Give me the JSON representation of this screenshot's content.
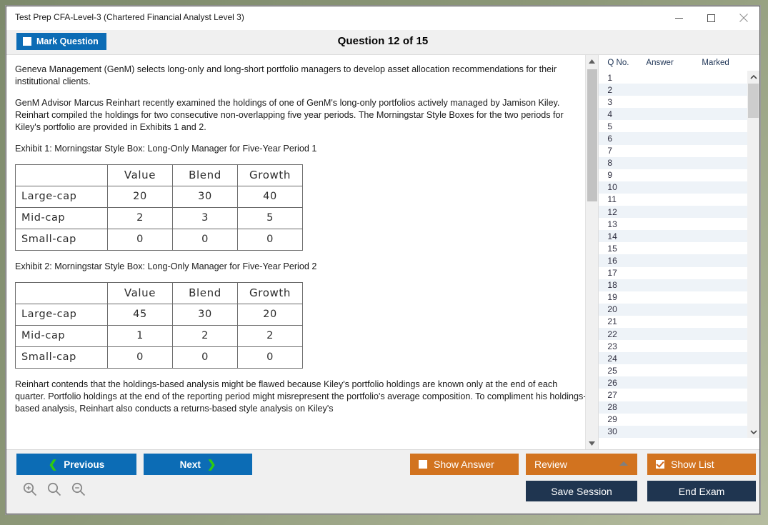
{
  "window": {
    "title": "Test Prep CFA-Level-3 (Chartered Financial Analyst Level 3)",
    "minimize_label": "minimize",
    "maximize_label": "maximize",
    "close_label": "close"
  },
  "header": {
    "mark_question_label": "Mark Question",
    "mark_question_checked": false,
    "question_title": "Question 12 of 15"
  },
  "content": {
    "paragraphs": [
      "Geneva Management (GenM) selects long-only and long-short portfolio managers to develop asset allocation recommendations for their institutional clients.",
      "GenM Advisor Marcus Reinhart recently examined the holdings of one of GenM's long-only portfolios actively managed by Jamison Kiley. Reinhart compiled the holdings for two consecutive non-overlapping five year periods. The Morningstar Style Boxes for the two periods for Kiley's portfolio are provided in Exhibits 1 and 2."
    ],
    "exhibit1_label": "Exhibit 1: Morningstar Style Box: Long-Only Manager for Five-Year Period 1",
    "exhibit2_label": "Exhibit 2: Morningstar Style Box: Long-Only Manager for Five-Year Period 2",
    "closing_paragraph": "Reinhart contends that the holdings-based analysis might be flawed because Kiley's portfolio holdings are known only at the end of each quarter. Portfolio holdings at the end of the reporting period might misrepresent the portfolio's average composition. To compliment his holdings-based analysis, Reinhart also conducts a returns-based style analysis on Kiley's",
    "exhibit1": {
      "corner": "",
      "columns": [
        "Value",
        "Blend",
        "Growth"
      ],
      "rows": [
        {
          "label": "Large-cap",
          "values": [
            "20",
            "30",
            "40"
          ]
        },
        {
          "label": "Mid-cap",
          "values": [
            "2",
            "3",
            "5"
          ]
        },
        {
          "label": "Small-cap",
          "values": [
            "0",
            "0",
            "0"
          ]
        }
      ]
    },
    "exhibit2": {
      "corner": "",
      "columns": [
        "Value",
        "Blend",
        "Growth"
      ],
      "rows": [
        {
          "label": "Large-cap",
          "values": [
            "45",
            "30",
            "20"
          ]
        },
        {
          "label": "Mid-cap",
          "values": [
            "1",
            "2",
            "2"
          ]
        },
        {
          "label": "Small-cap",
          "values": [
            "0",
            "0",
            "0"
          ]
        }
      ]
    }
  },
  "question_list": {
    "columns": [
      "Q No.",
      "Answer",
      "Marked"
    ],
    "rows": [
      {
        "no": "1",
        "answer": "",
        "marked": ""
      },
      {
        "no": "2",
        "answer": "",
        "marked": ""
      },
      {
        "no": "3",
        "answer": "",
        "marked": ""
      },
      {
        "no": "4",
        "answer": "",
        "marked": ""
      },
      {
        "no": "5",
        "answer": "",
        "marked": ""
      },
      {
        "no": "6",
        "answer": "",
        "marked": ""
      },
      {
        "no": "7",
        "answer": "",
        "marked": ""
      },
      {
        "no": "8",
        "answer": "",
        "marked": ""
      },
      {
        "no": "9",
        "answer": "",
        "marked": ""
      },
      {
        "no": "10",
        "answer": "",
        "marked": ""
      },
      {
        "no": "11",
        "answer": "",
        "marked": ""
      },
      {
        "no": "12",
        "answer": "",
        "marked": ""
      },
      {
        "no": "13",
        "answer": "",
        "marked": ""
      },
      {
        "no": "14",
        "answer": "",
        "marked": ""
      },
      {
        "no": "15",
        "answer": "",
        "marked": ""
      },
      {
        "no": "16",
        "answer": "",
        "marked": ""
      },
      {
        "no": "17",
        "answer": "",
        "marked": ""
      },
      {
        "no": "18",
        "answer": "",
        "marked": ""
      },
      {
        "no": "19",
        "answer": "",
        "marked": ""
      },
      {
        "no": "20",
        "answer": "",
        "marked": ""
      },
      {
        "no": "21",
        "answer": "",
        "marked": ""
      },
      {
        "no": "22",
        "answer": "",
        "marked": ""
      },
      {
        "no": "23",
        "answer": "",
        "marked": ""
      },
      {
        "no": "24",
        "answer": "",
        "marked": ""
      },
      {
        "no": "25",
        "answer": "",
        "marked": ""
      },
      {
        "no": "26",
        "answer": "",
        "marked": ""
      },
      {
        "no": "27",
        "answer": "",
        "marked": ""
      },
      {
        "no": "28",
        "answer": "",
        "marked": ""
      },
      {
        "no": "29",
        "answer": "",
        "marked": ""
      },
      {
        "no": "30",
        "answer": "",
        "marked": ""
      }
    ]
  },
  "footer": {
    "previous_label": "Previous",
    "next_label": "Next",
    "show_answer_label": "Show Answer",
    "show_answer_checked": false,
    "review_label": "Review",
    "show_list_label": "Show List",
    "show_list_checked": true,
    "save_session_label": "Save Session",
    "end_exam_label": "End Exam",
    "zoom_in_label": "zoom-in",
    "zoom_reset_label": "zoom-reset",
    "zoom_out_label": "zoom-out"
  },
  "colors": {
    "primary_blue": "#0c6cb5",
    "accent_orange": "#d2731f",
    "navy": "#1f3550",
    "chevron_green": "#2ecc0f",
    "row_alt": "#eef3f8"
  }
}
